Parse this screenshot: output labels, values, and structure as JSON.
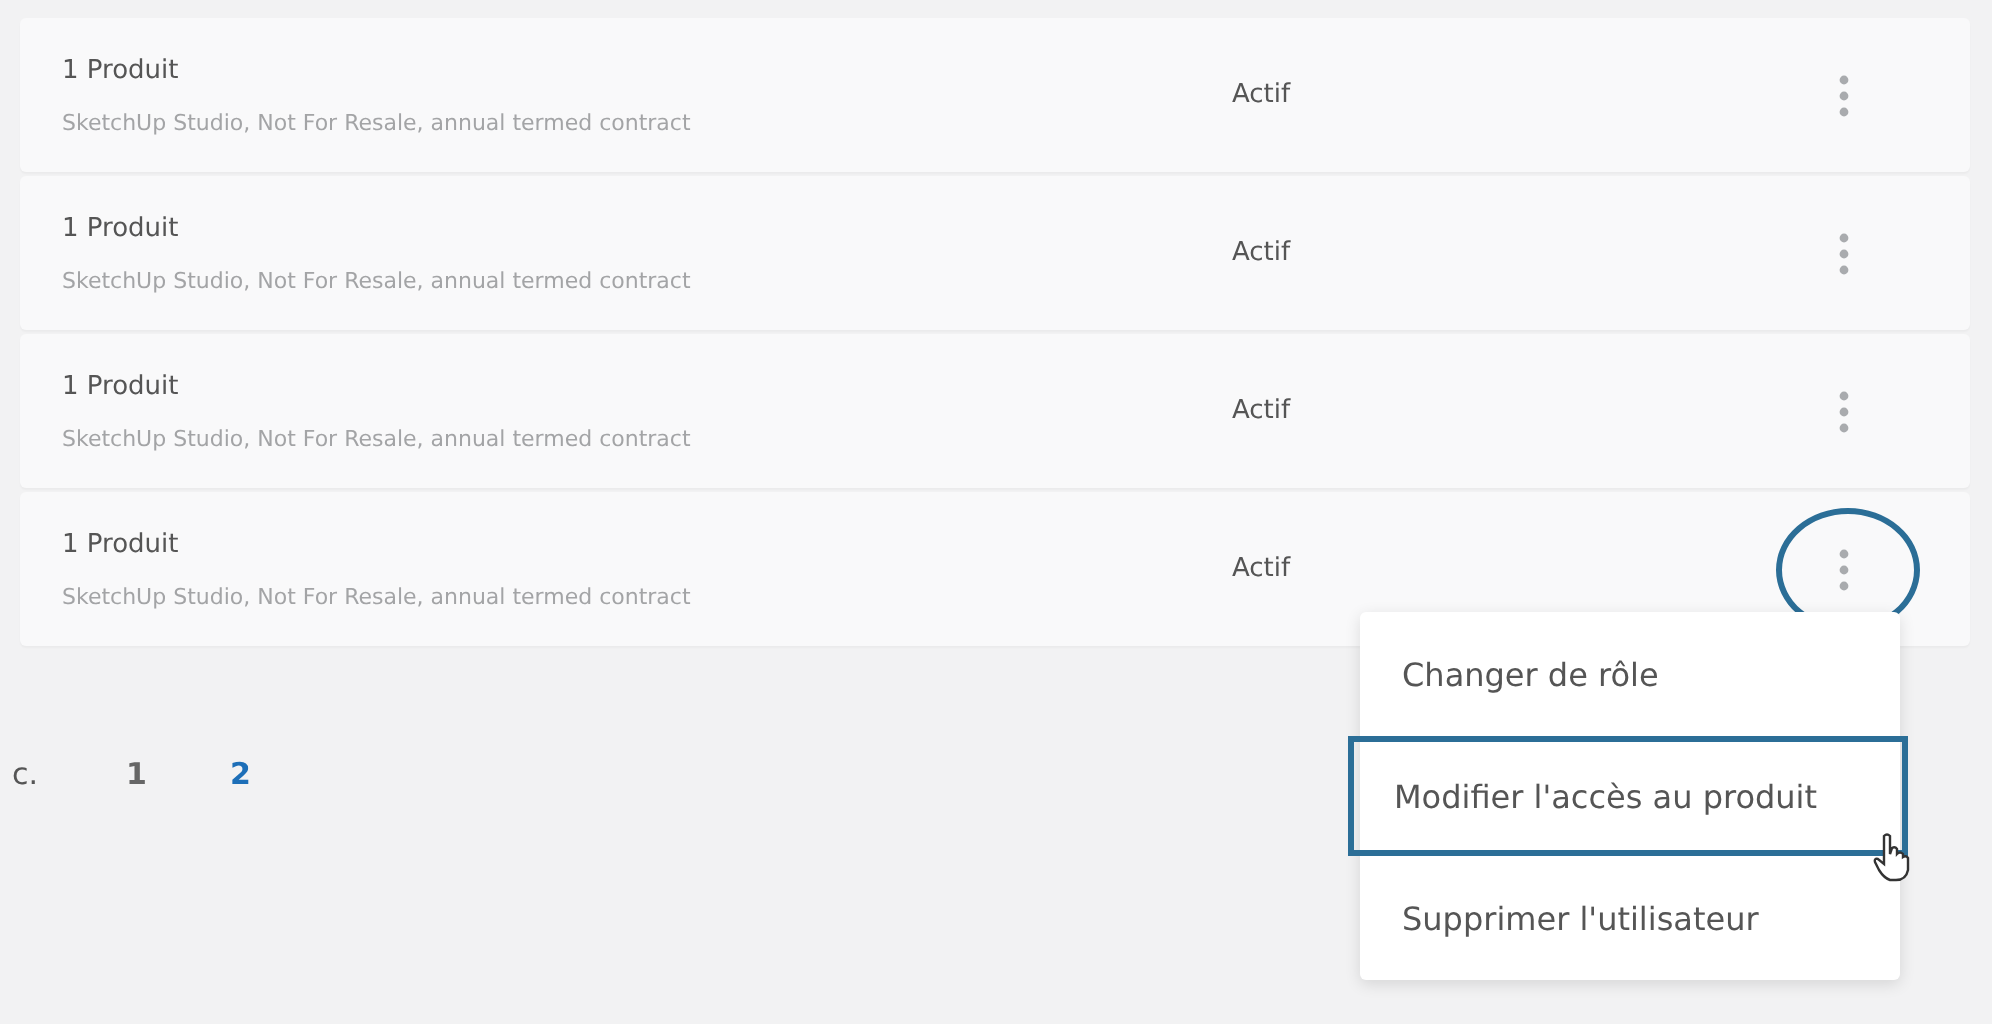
{
  "rows": [
    {
      "title": "1 Produit",
      "subtitle": "SketchUp Studio, Not For Resale, annual termed contract",
      "status": "Actif",
      "highlighted": false
    },
    {
      "title": "1 Produit",
      "subtitle": "SketchUp Studio, Not For Resale, annual termed contract",
      "status": "Actif",
      "highlighted": false
    },
    {
      "title": "1 Produit",
      "subtitle": "SketchUp Studio, Not For Resale, annual termed contract",
      "status": "Actif",
      "highlighted": false
    },
    {
      "title": "1 Produit",
      "subtitle": "SketchUp Studio, Not For Resale, annual termed contract",
      "status": "Actif",
      "highlighted": true
    }
  ],
  "pagination": {
    "previous": "c.",
    "pages": [
      {
        "label": "1",
        "selected": false
      },
      {
        "label": "2",
        "selected": true
      }
    ]
  },
  "menu": {
    "items": [
      {
        "label": "Changer de rôle",
        "highlighted": false
      },
      {
        "label": "Modifier l'accès au produit",
        "highlighted": true
      },
      {
        "label": "Supprimer l'utilisateur",
        "highlighted": false
      }
    ]
  }
}
